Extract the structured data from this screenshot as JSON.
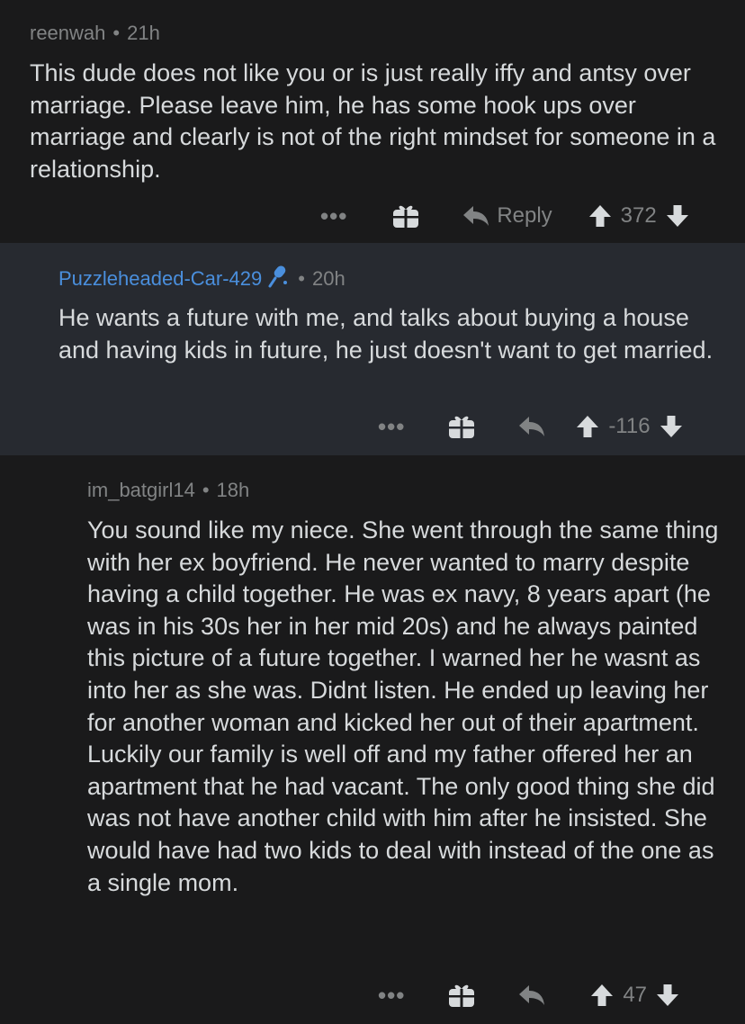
{
  "comments": [
    {
      "author": "reenwah",
      "time": "21h",
      "body": "This dude does not like you or is just really iffy and antsy over marriage. Please leave him, he has some hook ups over marriage and clearly is not of the right mindset for someone in a relationship.",
      "reply_label": "Reply",
      "score": "372"
    },
    {
      "author": "Puzzleheaded-Car-429",
      "time": "20h",
      "body": "He wants a future with me, and talks about buying a house and having kids in future, he just doesn't want to get married.",
      "score": "-116"
    },
    {
      "author": "im_batgirl14",
      "time": "18h",
      "body": "You sound like my niece. She went through the same thing with her ex boyfriend. He never wanted to marry despite having a child together. He was ex navy, 8 years apart (he was in his 30s her in her mid 20s) and he always painted this picture of a future together. I warned her he wasnt as into her as she was. Didnt listen. He ended up leaving her for another woman and kicked her out of their apartment. Luckily our family is well off and my father offered her an apartment that he had vacant. The only good thing she did was not have another child with him after he insisted. She would have had two kids to deal with instead of the one as a single mom.",
      "score": "47"
    }
  ],
  "separator": "•",
  "more_label": "•••",
  "colors": {
    "background": "#1a1a1b",
    "highlight_background": "#272a30",
    "text": "#d7dadc",
    "muted": "#818384",
    "op_author": "#4a8fdd"
  },
  "icons": [
    "more-icon",
    "gift-icon",
    "reply-icon",
    "upvote-icon",
    "downvote-icon",
    "mic-icon"
  ]
}
